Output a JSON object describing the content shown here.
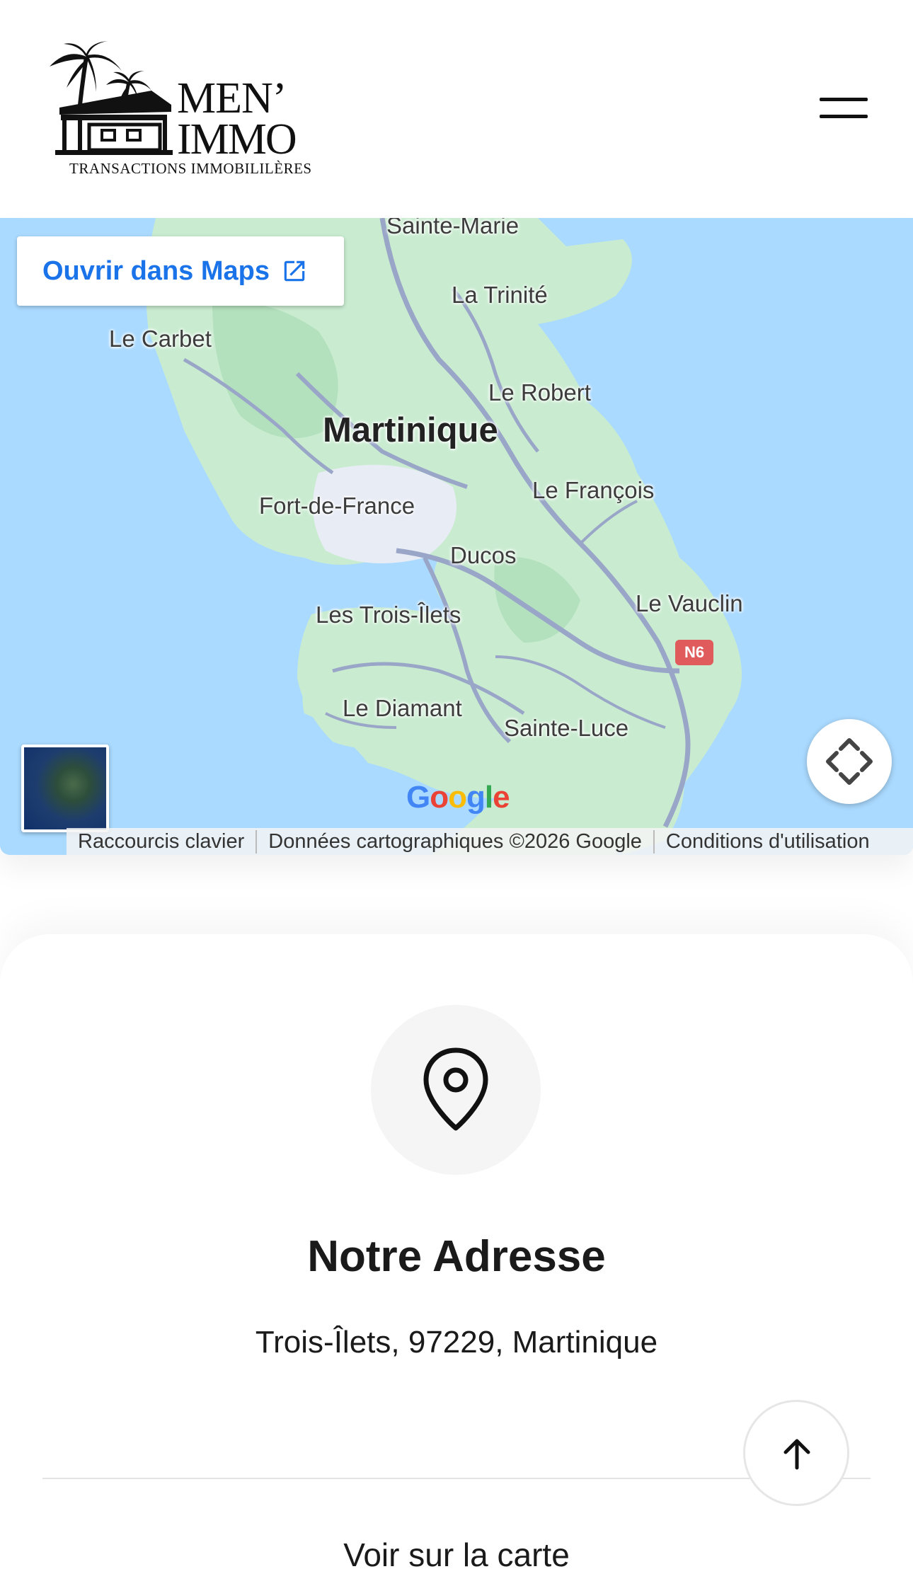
{
  "header": {
    "logo_word_1": "MEN’",
    "logo_word_2": "IMMO",
    "logo_tagline": "TRANSACTIONS IMMOBILILÈRES",
    "menu_icon": "hamburger-menu-icon"
  },
  "map": {
    "open_in_maps_label": "Ouvrir dans Maps",
    "open_icon": "external-link-icon",
    "places": {
      "sainte_marie": "Sainte-Marie",
      "la_trinite": "La Trinité",
      "le_carbet": "Le Carbet",
      "le_robert": "Le Robert",
      "martinique": "Martinique",
      "fort_de_france": "Fort-de-France",
      "le_francois": "Le François",
      "ducos": "Ducos",
      "les_trois_ilets": "Les Trois-Îlets",
      "le_vauclin": "Le Vauclin",
      "le_diamant": "Le Diamant",
      "sainte_luce": "Sainte-Luce",
      "road_n6": "N6"
    },
    "google_logo": "Google",
    "attribution": {
      "shortcuts": "Raccourcis clavier",
      "data": "Données cartographiques ©2026 Google",
      "terms": "Conditions d'utilisation"
    },
    "colors": {
      "water": "#aadaff",
      "land": "#c9ecd0",
      "road": "#9aa6c8",
      "link": "#1a73e8"
    }
  },
  "address": {
    "icon": "map-pin-icon",
    "title": "Notre Adresse",
    "value": "Trois-Îlets, 97229, Martinique",
    "see_map_label": "Voir sur la carte"
  },
  "scroll_top_icon": "arrow-up-icon"
}
